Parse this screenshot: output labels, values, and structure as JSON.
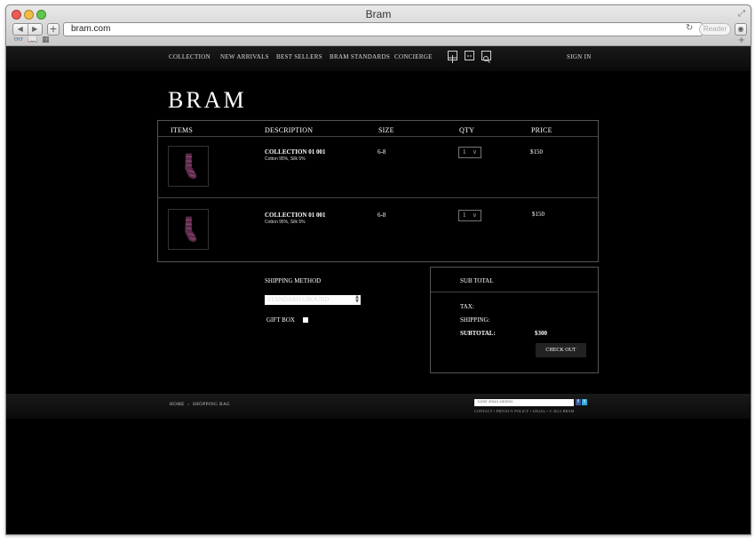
{
  "browser": {
    "title": "Bram",
    "url": "bram.com",
    "reader_label": "Reader"
  },
  "nav": {
    "items": [
      "COLLECTION",
      "NEW ARRIVALS",
      "BEST SELLERS",
      "BRAM STANDARDS",
      "CONCIERGE"
    ],
    "sign_in": "SIGN IN"
  },
  "logo": "BRAM",
  "cart": {
    "headers": {
      "items": "ITEMS",
      "description": "DESCRIPTION",
      "size": "SIZE",
      "qty": "QTY",
      "price": "PRICE"
    },
    "rows": [
      {
        "name": "COLLECTION 01 001",
        "material": "Cotton 95%, Silk 5%",
        "size": "6-8",
        "qty": "1",
        "price": "$150"
      },
      {
        "name": "COLLECTION 01 001",
        "material": "Cotton 95%, Silk 5%",
        "size": "6-8",
        "qty": "1",
        "price": "$150"
      }
    ]
  },
  "shipping": {
    "label": "SHIPPING METHOD",
    "selected": "STANDARD GROUND",
    "gift_label": "GIFT BOX"
  },
  "summary": {
    "title": "SUB TOTAL",
    "tax_label": "TAX:",
    "shipping_label": "SHIPPING:",
    "subtotal_label": "SUBTOTAL:",
    "subtotal_value": "$300",
    "checkout_label": "CHECK OUT"
  },
  "footer": {
    "breadcrumb_home": "HOME",
    "breadcrumb_sep": "›",
    "breadcrumb_current": "SHOPPING BAG",
    "email_placeholder": "Enter email address",
    "facebook": "f",
    "twitter": "t",
    "links": "CONTACT • PRIVACY POLICY • LEGAL • © 2012 BRAM"
  },
  "colors": {
    "background": "#000000",
    "sock": "#5c2a4a",
    "facebook": "#3b5998",
    "twitter": "#33aadd"
  }
}
